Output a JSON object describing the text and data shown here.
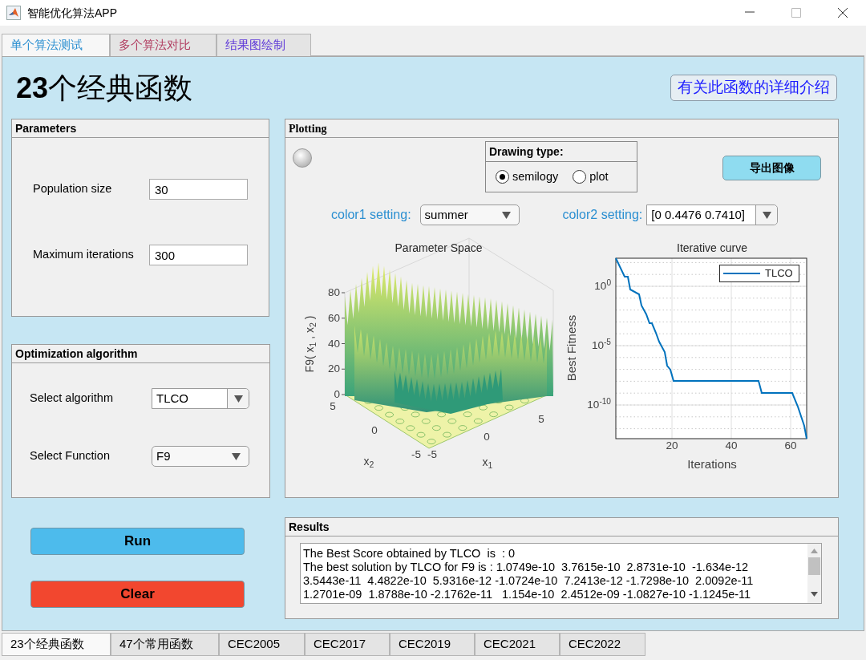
{
  "window": {
    "title": "智能优化算法APP"
  },
  "top_tabs": [
    {
      "label": "单个算法测试",
      "selected": true,
      "color": "#2b8fd1"
    },
    {
      "label": "多个算法对比",
      "selected": false,
      "color": "#b03a5e"
    },
    {
      "label": "结果图绘制",
      "selected": false,
      "color": "#5b35d8"
    }
  ],
  "heading": "**23**个经典函数",
  "info_button": "有关此函数的详细介绍",
  "parameters": {
    "title": "Parameters",
    "fields": [
      {
        "label": "Population size",
        "value": "30"
      },
      {
        "label": "Maximum iterations",
        "value": "300"
      }
    ]
  },
  "optimization": {
    "title": "Optimization algorithm",
    "selects": [
      {
        "label": "Select algorithm",
        "value": "TLCO",
        "kind": "split"
      },
      {
        "label": "Select Function",
        "value": "F9",
        "kind": "plain"
      }
    ]
  },
  "actions": [
    {
      "label": "Run",
      "color": "#4dbbec"
    },
    {
      "label": "Clear",
      "color": "#f2472f"
    }
  ],
  "plotting": {
    "title": "Plotting",
    "drawing_type": {
      "title": "Drawing type:",
      "options": [
        {
          "label": "semilogy",
          "selected": true
        },
        {
          "label": "plot",
          "selected": false
        }
      ]
    },
    "export_button": "导出图像",
    "color1": {
      "label": "color1 setting:",
      "value": "summer",
      "kind": "plain"
    },
    "color2": {
      "label": "color2 setting:",
      "value": "[0 0.4476 0.7410]",
      "kind": "split"
    },
    "surface_plot": {
      "title": "Parameter Space",
      "zlabel": "F9( x$_{1}$ , x$_{2}$ )",
      "zticks": [
        "80",
        "60",
        "40",
        "20",
        "0"
      ],
      "x2_ticks": [
        "5",
        "0",
        "-5"
      ],
      "x2_label": "x$_{2}$",
      "x1_ticks": [
        "-5",
        "0",
        "5"
      ],
      "x1_label": "x$_{1}$"
    },
    "curve_plot": {
      "title": "Iterative curve",
      "xlabel": "Iterations",
      "ylabel": "Best Fitness",
      "legend": "TLCO",
      "xticks": [
        "20",
        "40",
        "60"
      ],
      "yticks": [
        "10$^{0}$",
        "10$^{-5}$",
        "10$^{-10}$"
      ]
    }
  },
  "results": {
    "title": "Results",
    "lines": [
      "The Best Score obtained by TLCO  is  : 0",
      "The best solution by TLCO for F9 is : 1.0749e-10  3.7615e-10  2.8731e-10  -1.634e-12",
      "3.5443e-11  4.4822e-10  5.9316e-12 -1.0724e-10  7.2413e-12 -1.7298e-10  2.0092e-11",
      "1.2701e-09  1.8788e-10 -2.1762e-11   1.154e-10  2.4512e-09 -1.0827e-10 -1.1245e-11"
    ]
  },
  "bottom_tabs": [
    {
      "label": "23个经典函数",
      "selected": true
    },
    {
      "label": "47个常用函数",
      "selected": false
    },
    {
      "label": "CEC2005",
      "selected": false
    },
    {
      "label": "CEC2017",
      "selected": false
    },
    {
      "label": "CEC2019",
      "selected": false
    },
    {
      "label": "CEC2021",
      "selected": false
    },
    {
      "label": "CEC2022",
      "selected": false
    }
  ]
}
